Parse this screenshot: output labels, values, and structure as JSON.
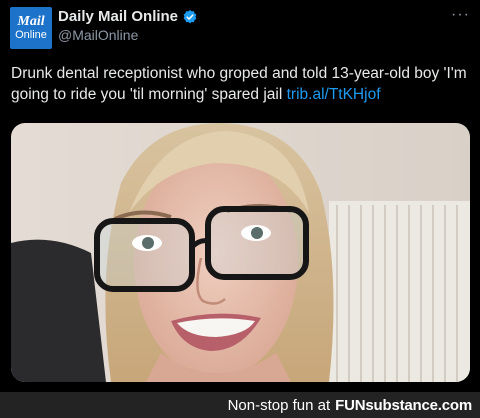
{
  "account": {
    "avatar_line1": "Mail",
    "avatar_line2": "Online",
    "name": "Daily Mail Online",
    "handle": "@MailOnline",
    "more": "···"
  },
  "tweet": {
    "text": "Drunk dental receptionist who groped and told 13-year-old boy 'I'm going to ride you 'til morning' spared jail ",
    "link": "trib.al/TtKHjof"
  },
  "footer": {
    "prefix": "Non-stop fun at",
    "brand": "FUNsubstance.com"
  },
  "colors": {
    "accent": "#1d9bf0",
    "avatar_bg": "#1d72c9",
    "background": "#000000"
  }
}
